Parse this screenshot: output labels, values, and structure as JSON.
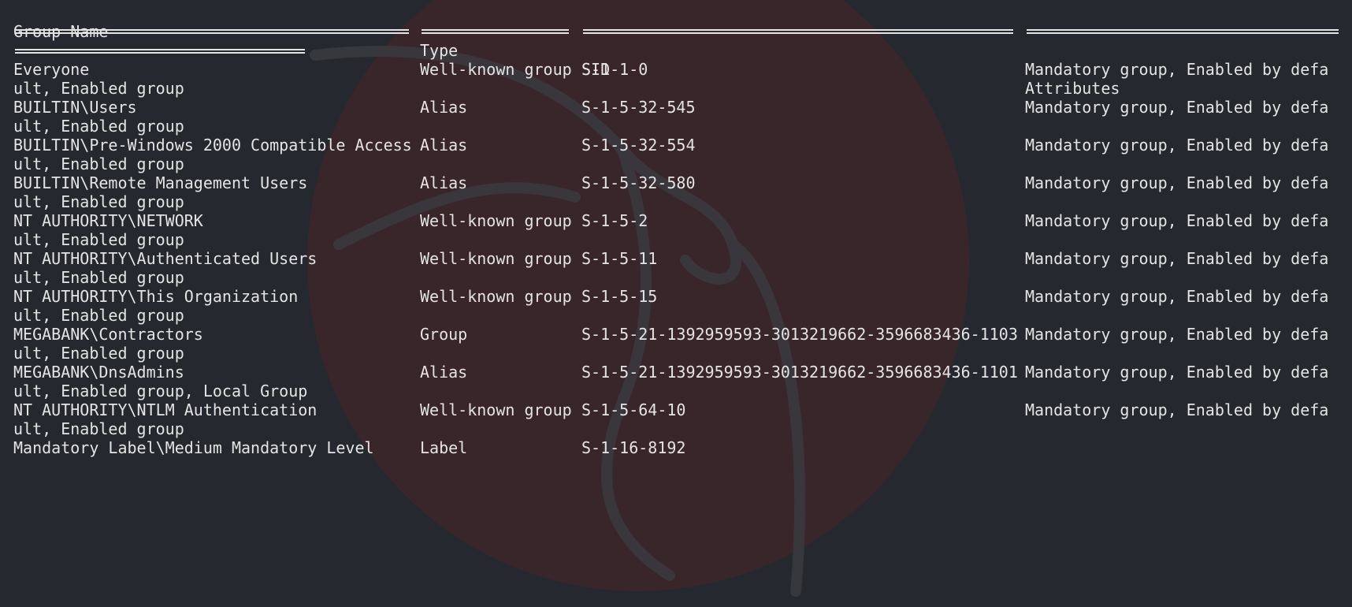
{
  "headers": {
    "group_name": "Group Name",
    "type": "Type",
    "sid": "SID",
    "attributes": "Attributes"
  },
  "rows": [
    {
      "name": "Everyone",
      "type": "Well-known group",
      "sid": "S-1-1-0",
      "attr": "Mandatory group, Enabled by defa",
      "cont": "ult, Enabled group"
    },
    {
      "name": "BUILTIN\\Users",
      "type": "Alias",
      "sid": "S-1-5-32-545",
      "attr": "Mandatory group, Enabled by defa",
      "cont": "ult, Enabled group"
    },
    {
      "name": "BUILTIN\\Pre-Windows 2000 Compatible Access",
      "type": "Alias",
      "sid": "S-1-5-32-554",
      "attr": "Mandatory group, Enabled by defa",
      "cont": "ult, Enabled group"
    },
    {
      "name": "BUILTIN\\Remote Management Users",
      "type": "Alias",
      "sid": "S-1-5-32-580",
      "attr": "Mandatory group, Enabled by defa",
      "cont": "ult, Enabled group"
    },
    {
      "name": "NT AUTHORITY\\NETWORK",
      "type": "Well-known group",
      "sid": "S-1-5-2",
      "attr": "Mandatory group, Enabled by defa",
      "cont": "ult, Enabled group"
    },
    {
      "name": "NT AUTHORITY\\Authenticated Users",
      "type": "Well-known group",
      "sid": "S-1-5-11",
      "attr": "Mandatory group, Enabled by defa",
      "cont": "ult, Enabled group"
    },
    {
      "name": "NT AUTHORITY\\This Organization",
      "type": "Well-known group",
      "sid": "S-1-5-15",
      "attr": "Mandatory group, Enabled by defa",
      "cont": "ult, Enabled group"
    },
    {
      "name": "MEGABANK\\Contractors",
      "type": "Group",
      "sid": "S-1-5-21-1392959593-3013219662-3596683436-1103",
      "attr": "Mandatory group, Enabled by defa",
      "cont": "ult, Enabled group"
    },
    {
      "name": "MEGABANK\\DnsAdmins",
      "type": "Alias",
      "sid": "S-1-5-21-1392959593-3013219662-3596683436-1101",
      "attr": "Mandatory group, Enabled by defa",
      "cont": "ult, Enabled group, Local Group"
    },
    {
      "name": "NT AUTHORITY\\NTLM Authentication",
      "type": "Well-known group",
      "sid": "S-1-5-64-10",
      "attr": "Mandatory group, Enabled by defa",
      "cont": "ult, Enabled group"
    },
    {
      "name": "Mandatory Label\\Medium Mandatory Level",
      "type": "Label",
      "sid": "S-1-16-8192",
      "attr": "",
      "cont": ""
    }
  ],
  "colors": {
    "background": "#25282e",
    "text": "#e4e4e4",
    "watermark_red": "#4a2528",
    "dragon": "#3a3b40"
  },
  "icons": {
    "watermark": "kali-dragon-logo"
  }
}
